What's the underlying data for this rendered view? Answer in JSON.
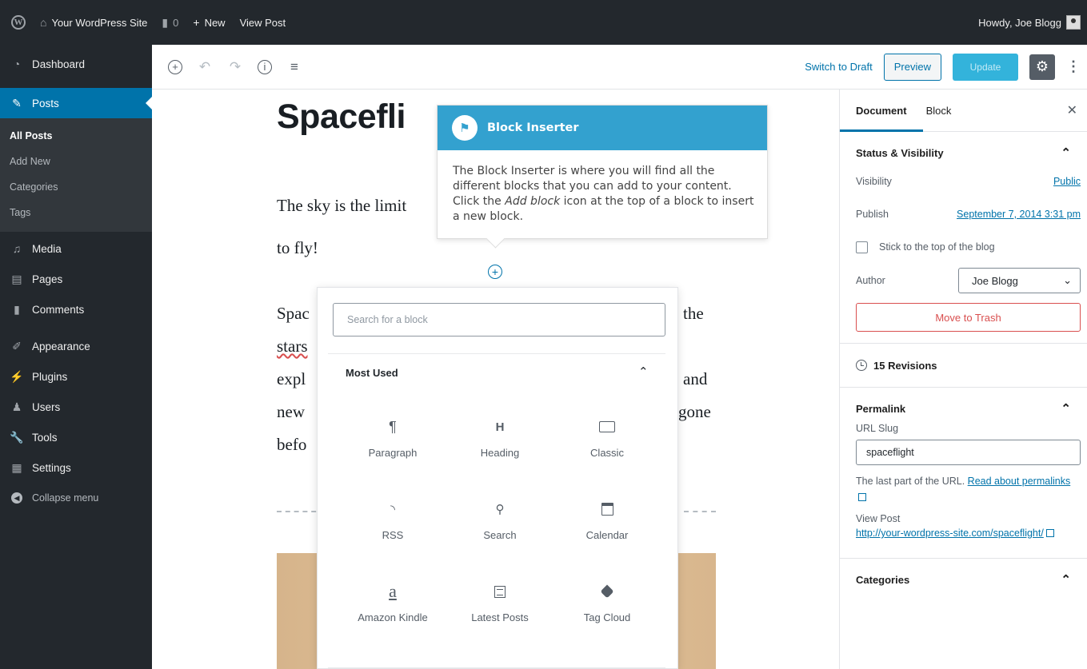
{
  "adminbar": {
    "site_name": "Your WordPress Site",
    "comments_count": "0",
    "new_label": "New",
    "view_post_label": "View Post",
    "howdy": "Howdy, Joe Blogg"
  },
  "sidebar": {
    "dashboard": "Dashboard",
    "posts": "Posts",
    "submenu": [
      "All Posts",
      "Add New",
      "Categories",
      "Tags"
    ],
    "media": "Media",
    "pages": "Pages",
    "comments": "Comments",
    "appearance": "Appearance",
    "plugins": "Plugins",
    "users": "Users",
    "tools": "Tools",
    "settings": "Settings",
    "collapse": "Collapse menu"
  },
  "toolbar": {
    "switch_draft": "Switch to Draft",
    "preview": "Preview",
    "update": "Update"
  },
  "post": {
    "title": "Spacefli",
    "p1_line1": "The sky is the limit",
    "p1_line2": "to fly!",
    "p2_left": [
      "Spac",
      "stars",
      "expl",
      "new",
      "befo"
    ],
    "p2_right": [
      "the",
      "",
      "and",
      "gone",
      ""
    ]
  },
  "tooltip": {
    "title": "Block Inserter",
    "body_1": "The Block Inserter is where you will find all the different blocks that you can add to your content. Click the ",
    "body_em": "Add block",
    "body_2": " icon at the top of a block to insert a new block."
  },
  "inserter": {
    "search_placeholder": "Search for a block",
    "group_title": "Most Used",
    "blocks": [
      {
        "label": "Paragraph",
        "icon": "paragraph-icon"
      },
      {
        "label": "Heading",
        "icon": "heading-icon"
      },
      {
        "label": "Classic",
        "icon": "keyboard-icon"
      },
      {
        "label": "RSS",
        "icon": "rss-icon"
      },
      {
        "label": "Search",
        "icon": "search-icon"
      },
      {
        "label": "Calendar",
        "icon": "calendar-icon"
      },
      {
        "label": "Amazon Kindle",
        "icon": "amazon-icon"
      },
      {
        "label": "Latest Posts",
        "icon": "list-icon"
      },
      {
        "label": "Tag Cloud",
        "icon": "tag-icon"
      }
    ]
  },
  "panel": {
    "tab_document": "Document",
    "tab_block": "Block",
    "status_title": "Status & Visibility",
    "visibility_label": "Visibility",
    "visibility_value": "Public",
    "publish_label": "Publish",
    "publish_value": "September 7, 2014 3:31 pm",
    "sticky_label": "Stick to the top of the blog",
    "author_label": "Author",
    "author_value": "Joe Blogg",
    "trash": "Move to Trash",
    "revisions": "15 Revisions",
    "permalink_title": "Permalink",
    "url_slug_label": "URL Slug",
    "url_slug_value": "spaceflight",
    "permalink_help": "The last part of the URL.",
    "permalink_link": "Read about permalinks",
    "view_post_label": "View Post",
    "view_post_url": "http://your-wordpress-site.com/spaceflight/",
    "categories_title": "Categories"
  }
}
